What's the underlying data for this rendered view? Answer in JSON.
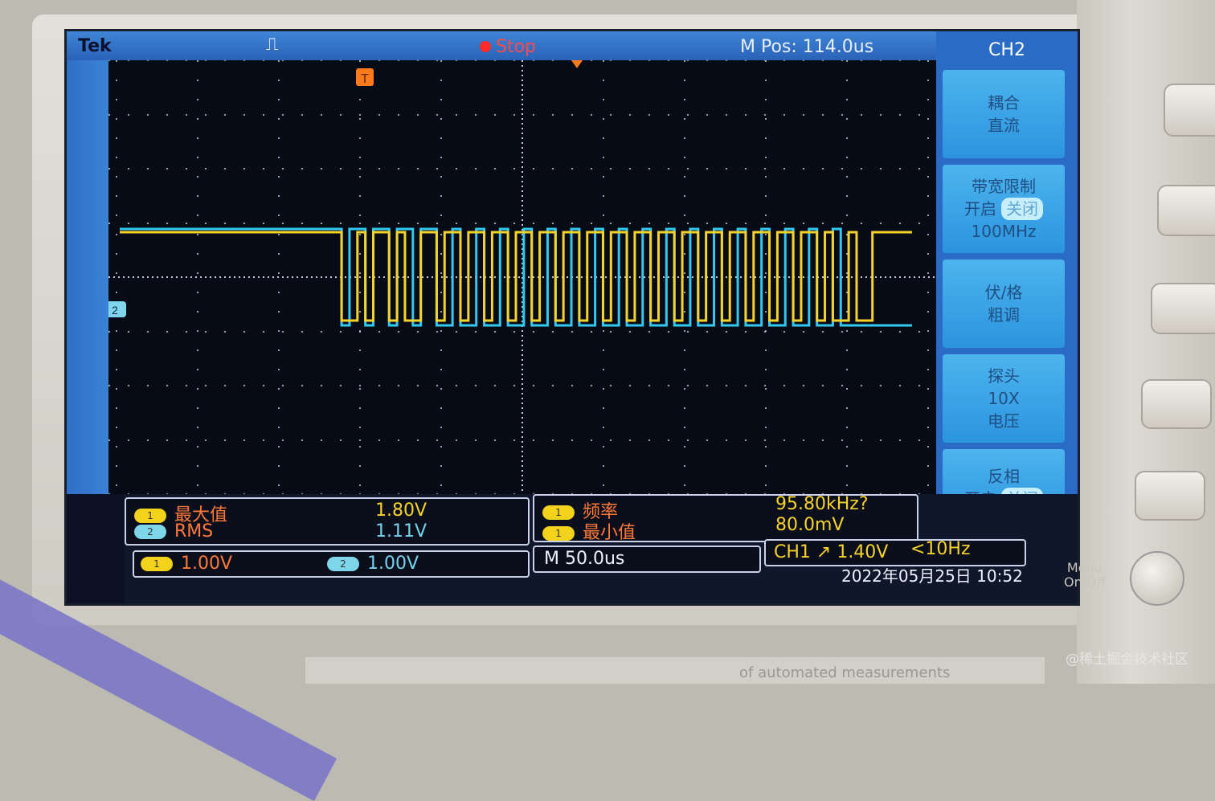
{
  "topbar": {
    "brand": "Tek",
    "trigger_icon": "⎍",
    "status": "Stop",
    "mpos": "M Pos: 114.0us"
  },
  "markers": {
    "trigger_marker": "T",
    "ch2_marker": "2"
  },
  "menu": {
    "title": "CH2",
    "items": [
      {
        "line1": "耦合",
        "line2": "直流",
        "line3": ""
      },
      {
        "line1": "带宽限制",
        "line2": "开启",
        "badge": "关闭",
        "line3": "100MHz"
      },
      {
        "line1": "伏/格",
        "line2": "粗调",
        "line3": ""
      },
      {
        "line1": "探头",
        "line2": "10X",
        "line3": "电压"
      },
      {
        "line1": "反相",
        "line2": "开启",
        "badge": "关闭",
        "line3": ""
      }
    ]
  },
  "measurements": {
    "left": [
      {
        "ch": "1",
        "label": "最大值",
        "value": "1.80V"
      },
      {
        "ch": "2",
        "label": "RMS",
        "value": "1.11V"
      }
    ],
    "right": [
      {
        "ch": "1",
        "label": "频率",
        "value": "95.80kHz?"
      },
      {
        "ch": "1",
        "label": "最小值",
        "value": "80.0mV"
      }
    ]
  },
  "status": {
    "ch1_scale_tag": "1",
    "ch1_scale": "1.00V",
    "ch2_scale_tag": "2",
    "ch2_scale": "1.00V",
    "timebase": "M 50.0us",
    "trigger": "CH1 ↗ 1.40V",
    "trigger_freq": "<10Hz",
    "datetime": "2022年05月25日 10:52"
  },
  "hardware": {
    "menu_button": "Menu\nOn/Off",
    "bottom_label": "of automated measurements"
  },
  "watermark": "@稀土掘金技术社区",
  "colors": {
    "ch1": "#f6d22a",
    "ch2": "#32c8f0",
    "grid": "#c8cfe0",
    "menu_bg": "#2a6cc5"
  },
  "waveform": {
    "description_data": {
      "ch1_high": 1,
      "ch1_low": 0,
      "ch1_transitions": [
        0.28,
        0.3,
        0.31,
        0.32,
        0.34,
        0.35,
        0.36,
        0.38,
        0.4,
        0.41,
        0.43,
        0.44,
        0.46,
        0.47,
        0.49,
        0.5,
        0.52,
        0.53,
        0.55,
        0.56,
        0.58,
        0.59,
        0.61,
        0.62,
        0.64,
        0.65,
        0.67,
        0.68,
        0.7,
        0.71,
        0.73,
        0.74,
        0.76,
        0.77,
        0.79,
        0.8,
        0.82,
        0.83,
        0.85,
        0.86,
        0.88,
        0.89,
        0.9,
        0.92,
        0.93,
        0.95
      ],
      "ch2_transitions": [
        0.28,
        0.29,
        0.31,
        0.32,
        0.34,
        0.35,
        0.37,
        0.38,
        0.4,
        0.42,
        0.43,
        0.45,
        0.46,
        0.48,
        0.49,
        0.51,
        0.52,
        0.54,
        0.55,
        0.57,
        0.58,
        0.6,
        0.61,
        0.63,
        0.64,
        0.66,
        0.67,
        0.69,
        0.7,
        0.72,
        0.73,
        0.75,
        0.76,
        0.78,
        0.79,
        0.81,
        0.82,
        0.84,
        0.85,
        0.87,
        0.88,
        0.9,
        0.91
      ]
    }
  }
}
